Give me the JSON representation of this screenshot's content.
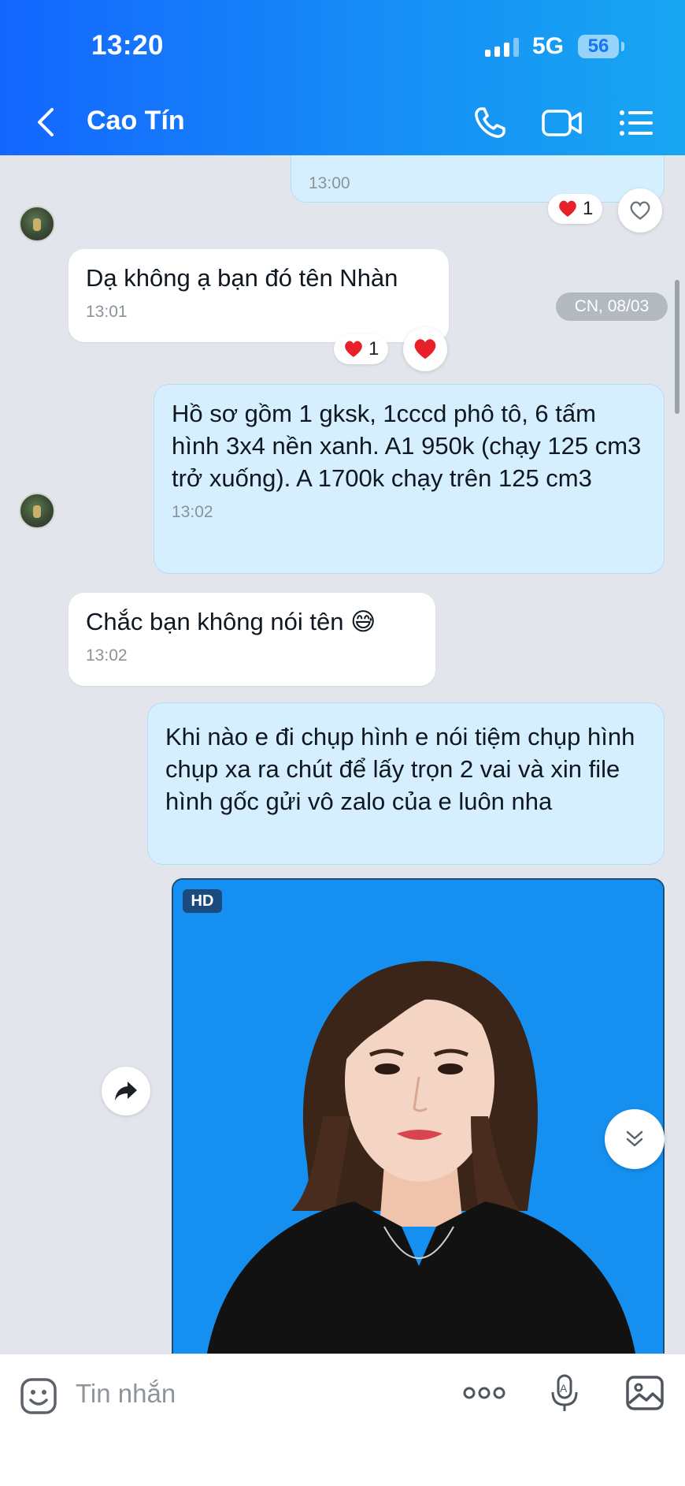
{
  "status_bar": {
    "time": "13:20",
    "network": "5G",
    "battery": "56"
  },
  "header": {
    "title": "Cao Tín"
  },
  "chat": {
    "top_message": {
      "time": "13:00",
      "reaction_count": "1"
    },
    "date_separator": "CN, 08/03",
    "messages": [
      {
        "text": "Dạ không ạ bạn đó tên Nhàn",
        "time": "13:01",
        "reaction_count": "1"
      },
      {
        "text": "Hồ sơ gồm 1 gksk, 1cccd phô tô, 6 tấm hình 3x4 nền xanh. A1 950k (chạy 125 cm3 trở xuống). A 1700k chạy trên 125 cm3",
        "time": "13:02"
      },
      {
        "text": "Chắc bạn không nói tên 😅",
        "time": "13:02"
      },
      {
        "text": "Khi nào e đi chụp hình e nói tiệm chụp hình chụp xa ra chút để lấy trọn 2 vai và xin file hình gốc gửi vô zalo của e luôn nha"
      }
    ],
    "photo": {
      "badge": "HD"
    }
  },
  "input_bar": {
    "placeholder": "Tin nhắn"
  },
  "colors": {
    "header_start": "#1466ff",
    "header_end": "#18a6f2",
    "outgoing_bubble": "#d6efff",
    "incoming_bubble": "#ffffff",
    "chat_background": "#e2e6ec",
    "photo_background": "#1590f0",
    "reaction_heart": "#e8202a"
  },
  "icons": {
    "back": "chevron-left-icon",
    "call": "phone-icon",
    "video": "video-camera-icon",
    "menu": "list-menu-icon",
    "sticker": "emoji-sticker-icon",
    "more": "more-dots-icon",
    "voice": "microphone-icon",
    "image": "image-icon",
    "share": "share-arrow-icon",
    "scroll_down": "double-chevron-down-icon"
  }
}
